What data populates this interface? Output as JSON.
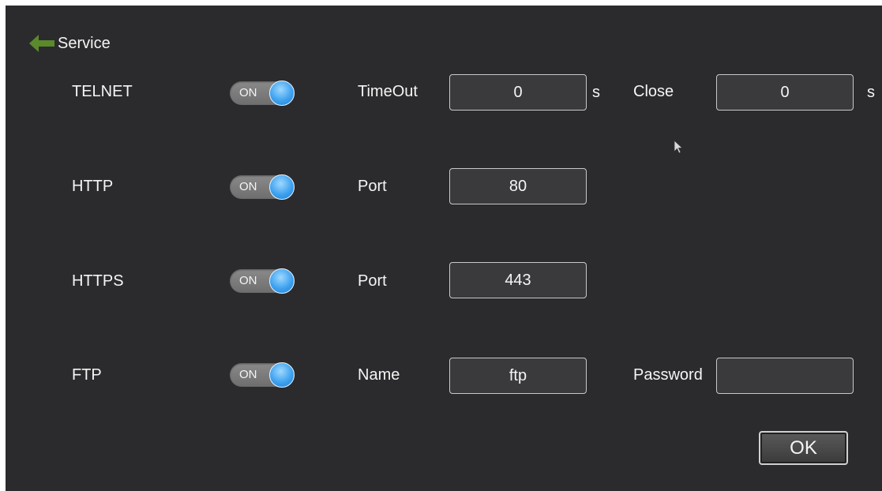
{
  "header": {
    "title": "Service",
    "back_icon": "back-arrow-icon",
    "back_icon_color": "#5a8a2c"
  },
  "rows": [
    {
      "service": "TELNET",
      "toggle": "ON",
      "field1_label": "TimeOut",
      "field1_value": "0",
      "field1_unit": "s",
      "field2_label": "Close",
      "field2_value": "0",
      "field2_unit": "s"
    },
    {
      "service": "HTTP",
      "toggle": "ON",
      "field1_label": "Port",
      "field1_value": "80"
    },
    {
      "service": "HTTPS",
      "toggle": "ON",
      "field1_label": "Port",
      "field1_value": "443"
    },
    {
      "service": "FTP",
      "toggle": "ON",
      "field1_label": "Name",
      "field1_value": "ftp",
      "field2_label": "Password",
      "field2_value": ""
    }
  ],
  "ok_label": "OK",
  "colors": {
    "background": "#2b2b2d",
    "toggle_knob": "#3ea2ef",
    "toggle_track": "#7a7a7a"
  }
}
